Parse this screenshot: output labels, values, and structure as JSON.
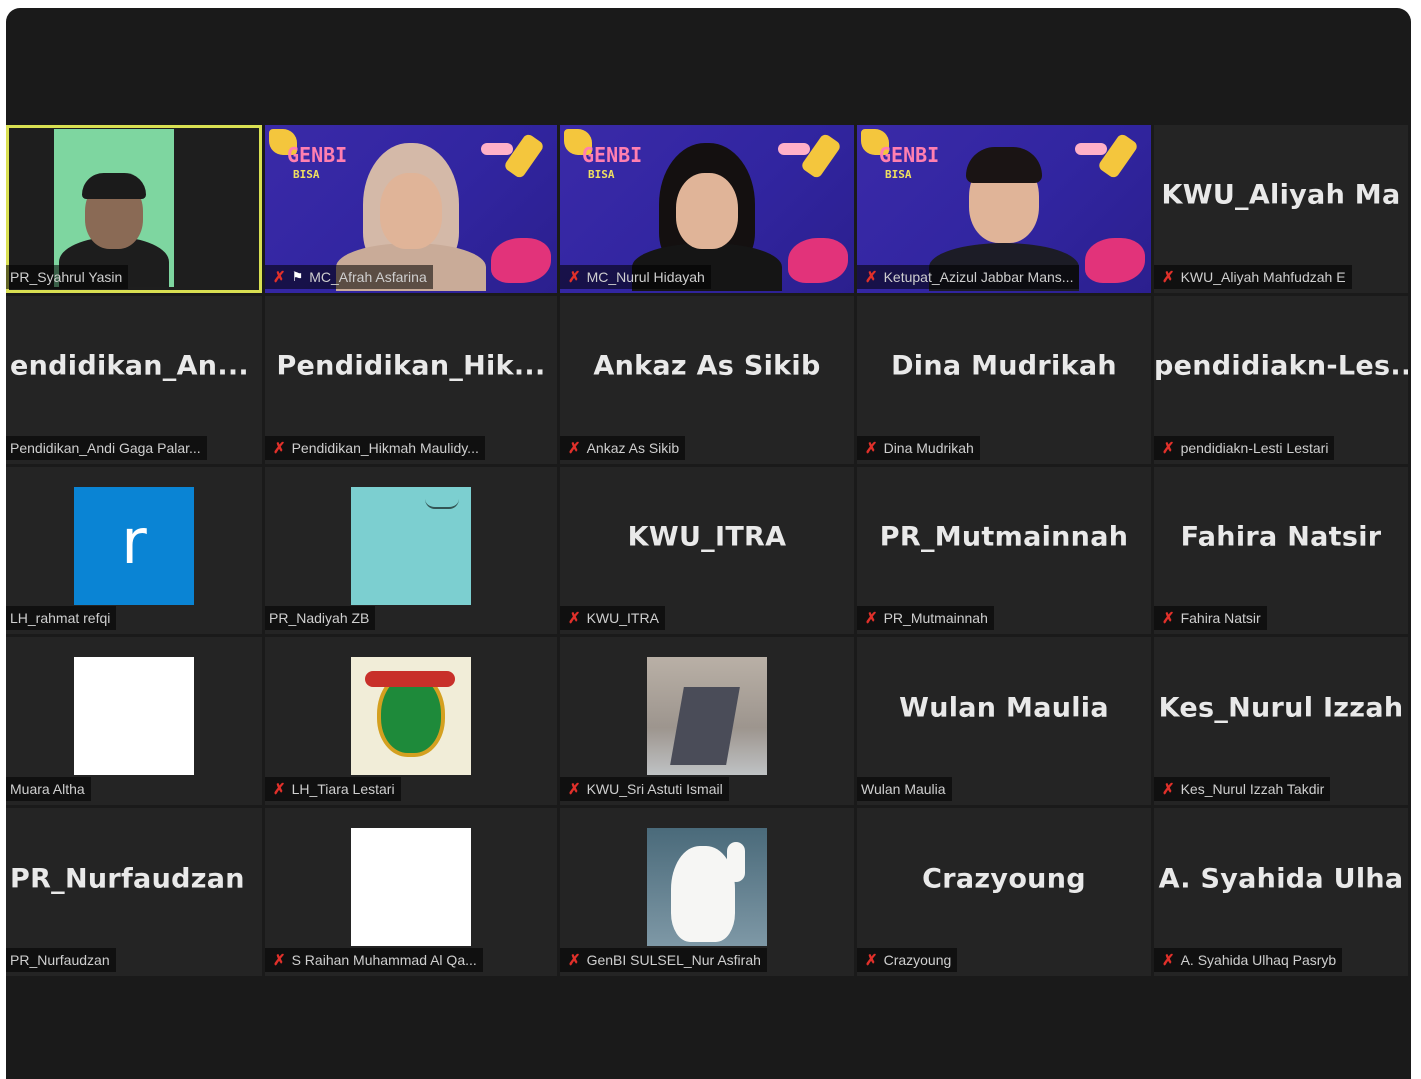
{
  "colors": {
    "window_bg": "#1a1a1a",
    "tile_bg": "#242424",
    "active_speaker_border": "#d9e052",
    "mic_muted": "#e0302a",
    "avatar_blue": "#0a84d4",
    "avatar_teal": "#7ccfd0"
  },
  "tiles": [
    {
      "kind": "video",
      "caption": "PR_Syahrul Yasin",
      "muted": false,
      "active": true
    },
    {
      "kind": "video",
      "caption": "MC_Afrah Asfarina",
      "muted": true,
      "pinned": true,
      "logo": "GENBI",
      "logo_sub": "BISA"
    },
    {
      "kind": "video",
      "caption": "MC_Nurul Hidayah",
      "muted": true,
      "logo": "GENBI",
      "logo_sub": "BISA"
    },
    {
      "kind": "video",
      "caption": "Ketupat_Azizul Jabbar Mans...",
      "muted": true,
      "logo": "GENBI",
      "logo_sub": "BISA"
    },
    {
      "kind": "name",
      "display": "KWU_Aliyah  Ma",
      "caption": "KWU_Aliyah Mahfudzah E",
      "muted": true
    },
    {
      "kind": "name",
      "display": "endidikan_An...",
      "caption": "Pendidikan_Andi Gaga Palar...",
      "muted": false
    },
    {
      "kind": "name",
      "display": "Pendidikan_Hik...",
      "caption": "Pendidikan_Hikmah Maulidy...",
      "muted": true
    },
    {
      "kind": "name",
      "display": "Ankaz As Sikib",
      "caption": "Ankaz As Sikib",
      "muted": true
    },
    {
      "kind": "name",
      "display": "Dina Mudrikah",
      "caption": "Dina Mudrikah",
      "muted": true
    },
    {
      "kind": "name",
      "display": "pendidiakn-Les...",
      "caption": "pendidiakn-Lesti Lestari",
      "muted": true
    },
    {
      "kind": "avatar",
      "avatar": "blue-letter",
      "letter": "r",
      "caption": "LH_rahmat refqi",
      "muted": false
    },
    {
      "kind": "avatar",
      "avatar": "teal-sketch",
      "caption": "PR_Nadiyah ZB",
      "muted": false
    },
    {
      "kind": "name",
      "display": "KWU_ITRA",
      "caption": "KWU_ITRA",
      "muted": true
    },
    {
      "kind": "name",
      "display": "PR_Mutmainnah",
      "caption": "PR_Mutmainnah",
      "muted": true
    },
    {
      "kind": "name",
      "display": "Fahira Natsir",
      "caption": "Fahira Natsir",
      "muted": true
    },
    {
      "kind": "avatar",
      "avatar": "white",
      "caption": "Muara Altha",
      "muted": false
    },
    {
      "kind": "avatar",
      "avatar": "emblem",
      "caption": "LH_Tiara Lestari",
      "muted": true
    },
    {
      "kind": "avatar",
      "avatar": "building",
      "caption": "KWU_Sri Astuti Ismail",
      "muted": true
    },
    {
      "kind": "name",
      "display": "Wulan Maulia",
      "caption": "Wulan Maulia",
      "muted": false
    },
    {
      "kind": "name",
      "display": "Kes_Nurul  Izzah",
      "caption": "Kes_Nurul Izzah Takdir",
      "muted": true
    },
    {
      "kind": "name",
      "display": "PR_Nurfaudzan",
      "caption": "PR_Nurfaudzan",
      "muted": false
    },
    {
      "kind": "avatar",
      "avatar": "white",
      "caption": "S Raihan Muhammad Al Qa...",
      "muted": true
    },
    {
      "kind": "avatar",
      "avatar": "cat",
      "caption": "GenBI SULSEL_Nur Asfirah",
      "muted": true
    },
    {
      "kind": "name",
      "display": "Crazyoung",
      "caption": "Crazyoung",
      "muted": true
    },
    {
      "kind": "name",
      "display": "A. Syahida  Ulha",
      "caption": "A. Syahida Ulhaq Pasryb",
      "muted": true
    }
  ]
}
